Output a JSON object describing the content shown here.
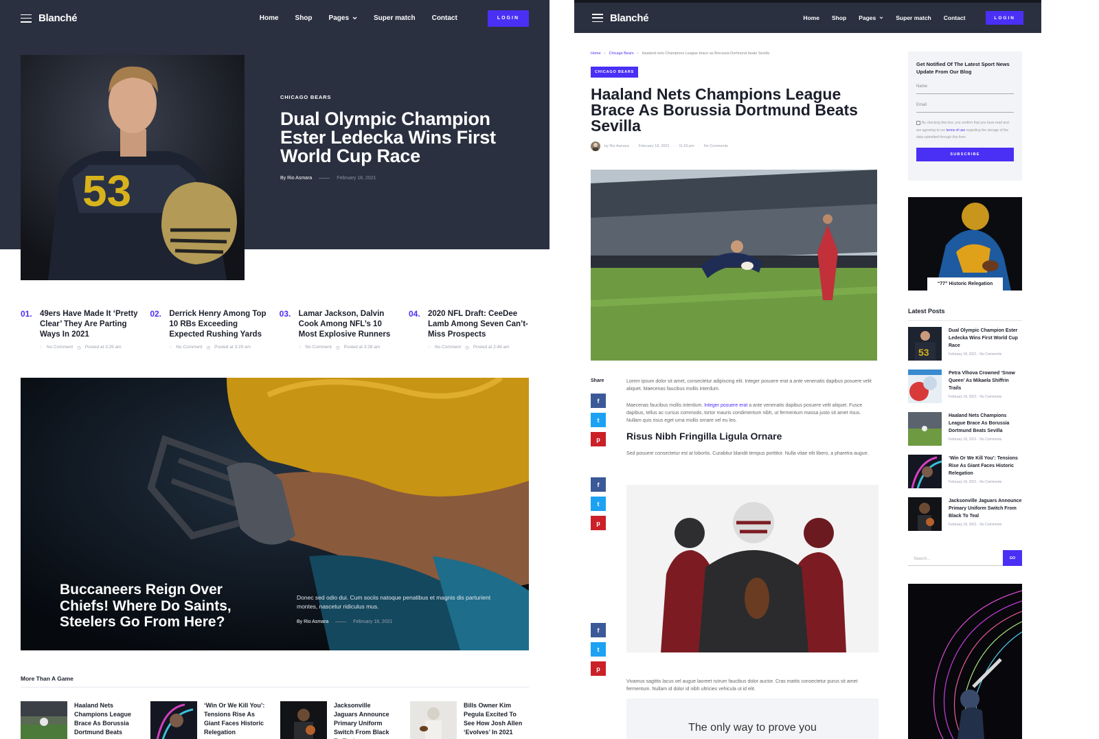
{
  "left": {
    "nav": {
      "logo": "Blanché",
      "items": [
        "Home",
        "Shop",
        "Pages",
        "Super match",
        "Contact"
      ],
      "login": "LOGIN"
    },
    "hero": {
      "category": "CHICAGO BEARS",
      "title": "Dual Olympic Champion Ester Ledecka Wins First World Cup Race",
      "author": "By Rio Asmara",
      "date": "February 18, 2021"
    },
    "numbered": [
      {
        "num": "01.",
        "title": "49ers Have Made It ‘Pretty Clear’ They Are Parting Ways In 2021",
        "comment": "No Comment",
        "time": "Posted at 3:29 am"
      },
      {
        "num": "02.",
        "title": "Derrick Henry Among Top 10 RBs Exceeding Expected Rushing Yards",
        "comment": "No Comment",
        "time": "Posted at 3:29 am"
      },
      {
        "num": "03.",
        "title": "Lamar Jackson, Dalvin Cook Among NFL’s 10 Most Explosive Runners",
        "comment": "No Comment",
        "time": "Posted at 3:28 am"
      },
      {
        "num": "04.",
        "title": "2020 NFL Draft: CeeDee Lamb Among Seven Can’t-Miss Prospects",
        "comment": "No Comment",
        "time": "Posted at 2:48 am"
      }
    ],
    "feature": {
      "title": "Buccaneers Reign Over Chiefs! Where Do Saints, Steelers Go From Here?",
      "excerpt": "Donec sed odio dui. Cum sociis natoque penatibus et magnis dis parturient montes, nascetur ridiculus mus.",
      "author": "By Rio Asmara",
      "date": "February 18, 2021"
    },
    "more": {
      "heading": "More Than A Game",
      "items": [
        "Haaland Nets Champions League Brace As Borussia Dortmund Beats",
        "‘Win Or We Kill You’: Tensions Rise As Giant Faces Historic Relegation",
        "Jacksonville Jaguars Announce Primary Uniform Switch From Black To Teal",
        "Bills Owner Kim Pegula Excited To See How Josh Allen ‘Evolves’ In 2021"
      ]
    }
  },
  "right": {
    "nav": {
      "logo": "Blanché",
      "items": [
        "Home",
        "Shop",
        "Pages",
        "Super match",
        "Contact"
      ],
      "login": "LOGIN"
    },
    "breadcrumbs": [
      "Home",
      "Chicago Bears",
      "Haaland nets Champions League brace as Borussia Dortmund beats Sevilla"
    ],
    "category": "CHICAGO BEARS",
    "title": "Haaland Nets Champions League Brace As Borussia Dortmund Beats Sevilla",
    "meta": {
      "author": "by Rio Asmara",
      "date": "February 18, 2021",
      "time": "11:50 pm",
      "comments": "No Comments"
    },
    "share_label": "Share",
    "p1": "Lorem ipsum dolor sit amet, consectetur adipiscing elit. Integer posuere erat a ante venenatis dapibus posuere velit aliquet. Maecenas faucibus mollis interdum.",
    "p2": {
      "before": "Maecenas faucibus mollis interdum. ",
      "link": "Integer posuere erat",
      "after": " a ante venenatis dapibus posuere velit aliquet. Fusce dapibus, tellus ac cursus commodo, tortor mauris condimentum nibh, ut fermentum massa justo sit amet risus. Nullam quis risus eget urna mollis ornare vel eu leo."
    },
    "subheading": "Risus Nibh Fringilla Ligula Ornare",
    "p3": "Sed posuere consectetur est at lobortis. Curabitur blandit tempus porttitor. Nulla vitae elit libero, a pharetra augue.",
    "p4": "Vivamus sagittis lacus vel augue laoreet rutrum faucibus dolor auctor. Cras mattis consectetur purus sit amet fermentum. Nullam id dolor id nibh ultricies vehicula ut id elit.",
    "quote": "The only way to prove you",
    "newsletter": {
      "heading": "Get Notified Of The Latest Sport News Update From Our Blog",
      "name_placeholder": "Name",
      "email_placeholder": "Email",
      "consent_before": "By checking this box, you confirm that you have read and are agreeing to our ",
      "consent_link": "terms of use",
      "consent_after": " regarding the storage of the data submitted through this form.",
      "button": "SUBSCRIBE"
    },
    "ad_caption": "“77” Historic Relegation",
    "latest": {
      "heading": "Latest Posts",
      "items": [
        {
          "title": "Dual Olympic Champion Ester Ledecka Wins First World Cup Race",
          "meta": "February 18, 2021 · No Comments"
        },
        {
          "title": "Petra Vlhova Crowned ‘Snow Queen’ As Mikaela Shiffrin Trails",
          "meta": "February 18, 2021 · No Comments"
        },
        {
          "title": "Haaland Nets Champions League Brace As Borussia Dortmund Beats Sevilla",
          "meta": "February 18, 2021 · No Comments"
        },
        {
          "title": "‘Win Or We Kill You’: Tensions Rise As Giant Faces Historic Relegation",
          "meta": "February 18, 2021 · No Comments"
        },
        {
          "title": "Jacksonville Jaguars Announce Primary Uniform Switch From Black To Teal",
          "meta": "February 18, 2021 · No Comments"
        }
      ]
    },
    "search": {
      "placeholder": "Search...",
      "button": "GO"
    }
  },
  "colors": {
    "accent": "#4a2ff5",
    "nav": "#2b3040",
    "facebook": "#3b5998",
    "twitter": "#1da1f2",
    "pinterest": "#cb2027"
  },
  "icons": [
    "hamburger-icon",
    "chevron-down-icon",
    "comment-icon",
    "clock-icon",
    "facebook-icon",
    "twitter-icon",
    "pinterest-icon"
  ]
}
